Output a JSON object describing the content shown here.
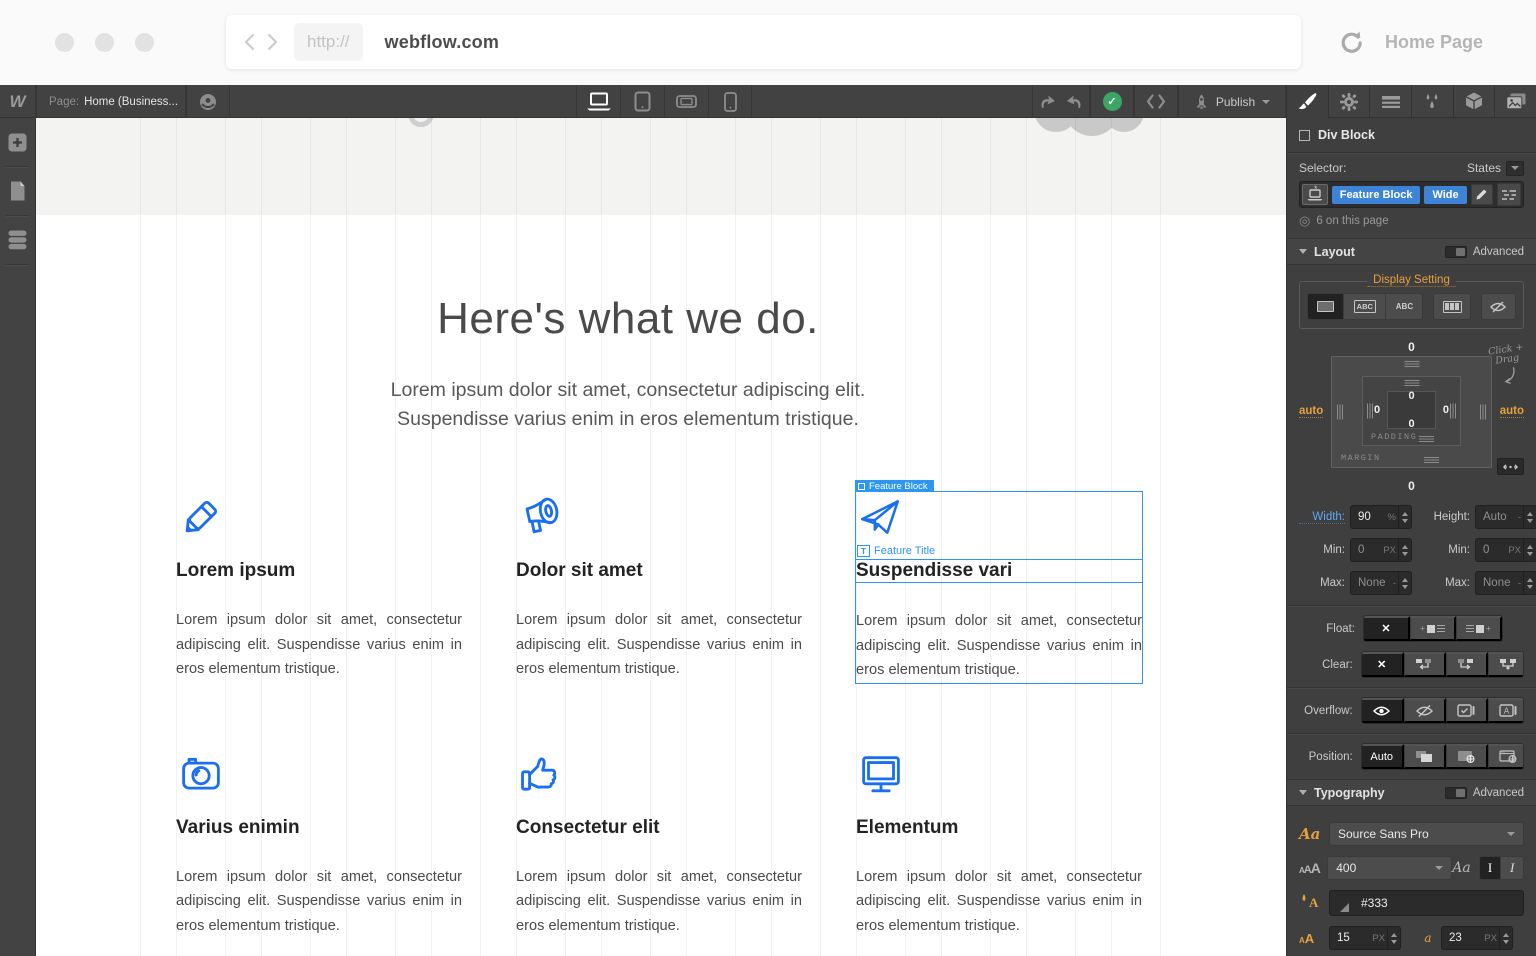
{
  "browser": {
    "scheme": "http://",
    "url": "webflow.com",
    "page_title": "Home Page"
  },
  "topbar": {
    "logo": "W",
    "page_label": "Page:",
    "page_name": "Home (Business...",
    "publish": "Publish",
    "devices": [
      "desktop",
      "tablet",
      "mobile-landscape",
      "mobile-portrait"
    ],
    "tabs": [
      "style-brush",
      "settings-gear",
      "element-settings",
      "interactions",
      "components",
      "assets"
    ]
  },
  "panel": {
    "element_type": "Div Block",
    "selector_label": "Selector:",
    "states_label": "States",
    "classes": [
      "Feature Block",
      "Wide"
    ],
    "usage": "6 on this page",
    "glyphs": {
      "none": "✕",
      "abc": "ABC",
      "font_preview": "Aa",
      "weight_preview": "AAA",
      "italic": "I",
      "size_a": "A",
      "line_height_a": "a",
      "target": "◎",
      "asterisk": "*",
      "letter_t": "T"
    },
    "layout": {
      "title": "Layout",
      "advanced": "Advanced",
      "display_setting": "Display Setting",
      "box": {
        "margin_top": "0",
        "margin_bottom": "0",
        "margin_left": "auto",
        "margin_right": "auto",
        "padding_top": "0",
        "padding_bottom": "0",
        "padding_left": "0",
        "padding_right": "0",
        "padding_label": "PADDING",
        "margin_label": "MARGIN",
        "hint": "Click + Drag"
      },
      "width_label": "Width:",
      "width": "90",
      "width_unit": "%",
      "height_label": "Height:",
      "height": "Auto",
      "height_unit": "-",
      "min_label": "Min:",
      "min_w": "0",
      "min_w_unit": "PX",
      "min_h": "0",
      "min_h_unit": "PX",
      "max_label": "Max:",
      "max_w": "None",
      "max_w_unit": "-",
      "max_h": "None",
      "max_h_unit": "-",
      "float_label": "Float:",
      "clear_label": "Clear:",
      "overflow_label": "Overflow:",
      "position_label": "Position:",
      "position_value": "Auto"
    },
    "typography": {
      "title": "Typography",
      "advanced": "Advanced",
      "font": "Source Sans Pro",
      "weight": "400",
      "color": "#333",
      "size": "15",
      "size_unit": "PX",
      "line_height": "23",
      "line_height_unit": "PX"
    }
  },
  "canvas": {
    "heading": "Here's what we do.",
    "subtitle1": "Lorem ipsum dolor sit amet, consectetur adipiscing elit.",
    "subtitle2": "Suspendisse varius enim in eros elementum tristique.",
    "body": "Lorem ipsum dolor sit amet, consectetur adipiscing elit. Suspendisse varius enim in eros elementum tristique.",
    "selected_badge": "Feature Block",
    "selected_title_label": "Feature Title",
    "features": [
      {
        "icon": "pencil-icon",
        "title": "Lorem ipsum"
      },
      {
        "icon": "megaphone-icon",
        "title": "Dolor sit amet"
      },
      {
        "icon": "paper-plane-icon",
        "title": "Suspendisse vari"
      },
      {
        "icon": "camera-icon",
        "title": "Varius enimin"
      },
      {
        "icon": "thumbs-up-icon",
        "title": "Consectetur elit"
      },
      {
        "icon": "monitor-icon",
        "title": "Elementum"
      }
    ]
  },
  "colors": {
    "selection_blue": "#2d96f2",
    "class_chip_blue": "#3e84d6",
    "icon_blue": "#1a6ff0",
    "accent_orange": "#e7a03c",
    "publish_green": "#3ba564"
  }
}
